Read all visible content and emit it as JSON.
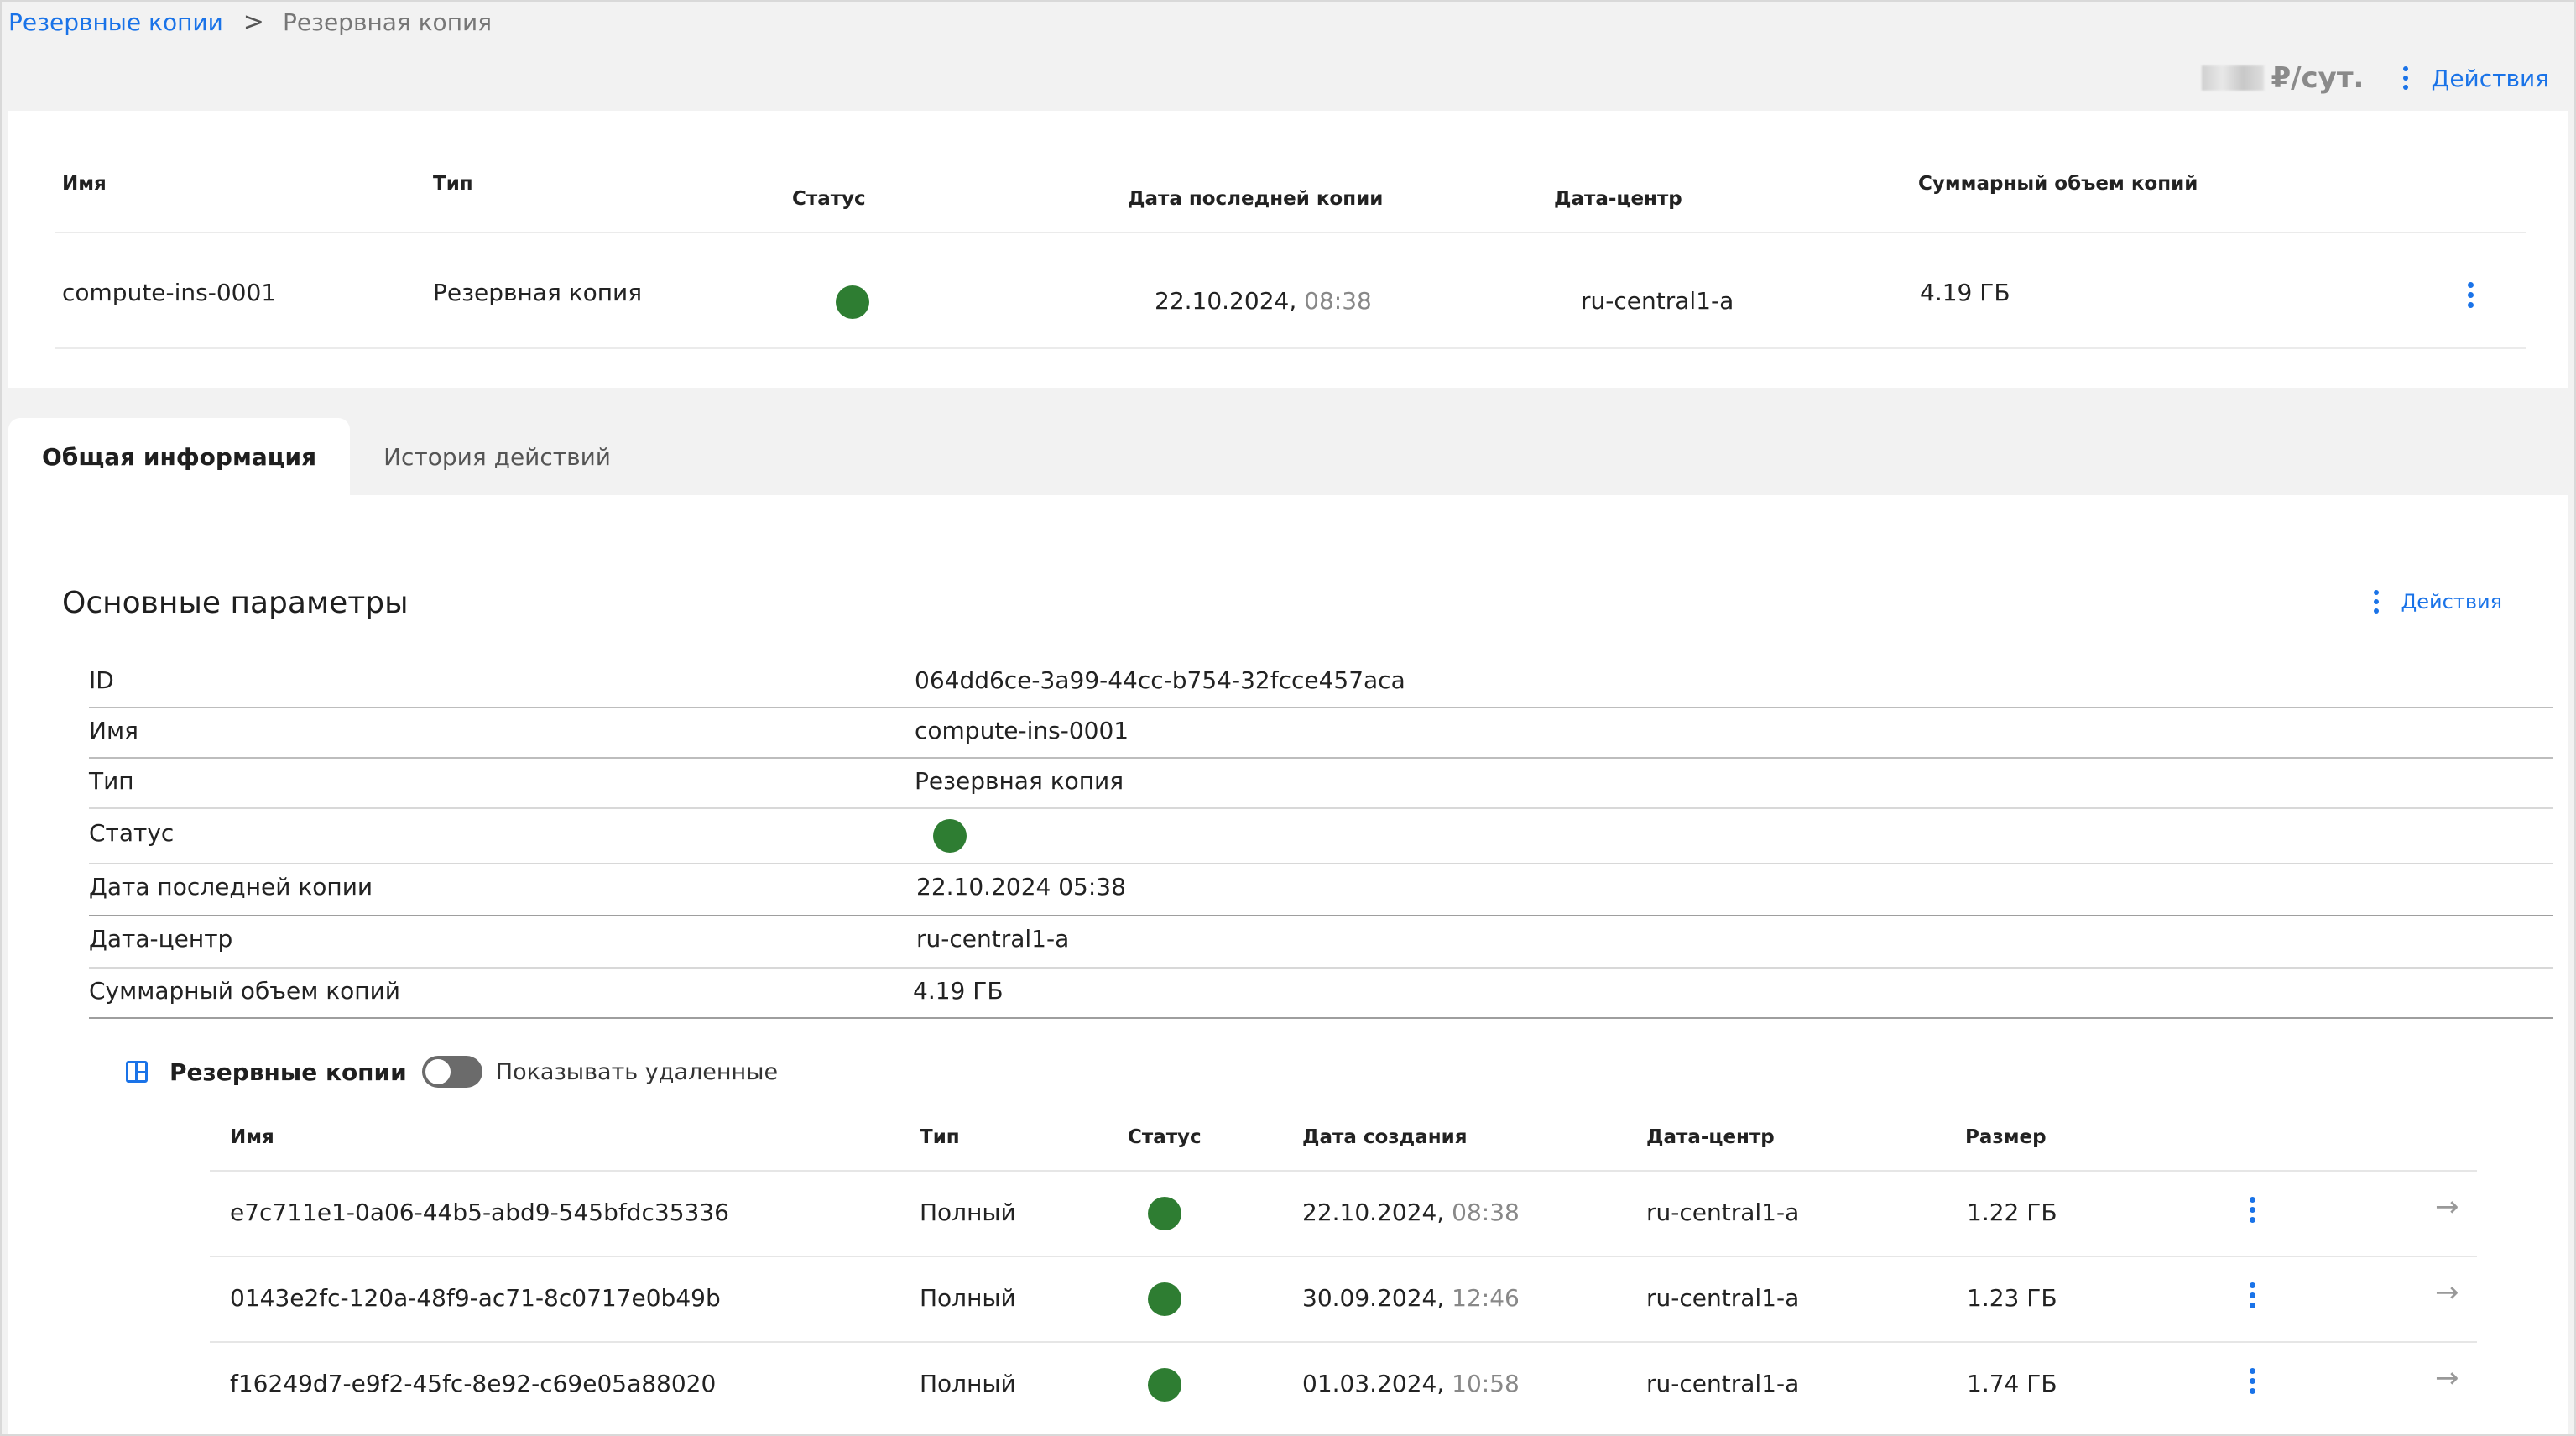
{
  "breadcrumb": {
    "root": "Резервные копии",
    "separator": ">",
    "current": "Резервная копия"
  },
  "top": {
    "price_unit": "₽/сут.",
    "actions_label": "Действия"
  },
  "summary": {
    "headers": {
      "name": "Имя",
      "type": "Тип",
      "status": "Статус",
      "last_copy": "Дата последней копии",
      "datacenter": "Дата-центр",
      "total_size": "Суммарный объем копий"
    },
    "row": {
      "name": "compute-ins-0001",
      "type": "Резервная копия",
      "status_color": "#2e7d32",
      "date": "22.10.2024,",
      "time": "08:38",
      "datacenter": "ru-central1-a",
      "total_size": "4.19 ГБ"
    }
  },
  "tabs": [
    {
      "label": "Общая информация",
      "active": true
    },
    {
      "label": "История действий",
      "active": false
    }
  ],
  "params": {
    "title": "Основные параметры",
    "actions_label": "Действия",
    "rows": [
      {
        "key": "ID",
        "value": "064dd6ce-3a99-44cc-b754-32fcce457aca"
      },
      {
        "key": "Имя",
        "value": "compute-ins-0001"
      },
      {
        "key": "Тип",
        "value": "Резервная копия"
      },
      {
        "key": "Статус",
        "value": ""
      },
      {
        "key": "Дата последней копии",
        "value": "22.10.2024 05:38"
      },
      {
        "key": "Дата-центр",
        "value": "ru-central1-a"
      },
      {
        "key": "Суммарный объем копий",
        "value": "4.19 ГБ"
      }
    ]
  },
  "backups": {
    "title": "Резервные копии",
    "toggle_label": "Показывать удаленные",
    "toggle_on": false,
    "headers": {
      "name": "Имя",
      "type": "Тип",
      "status": "Статус",
      "created": "Дата создания",
      "datacenter": "Дата-центр",
      "size": "Размер"
    },
    "rows": [
      {
        "name": "e7c711e1-0a06-44b5-abd9-545bfdc35336",
        "type": "Полный",
        "date": "22.10.2024,",
        "time": "08:38",
        "datacenter": "ru-central1-a",
        "size": "1.22 ГБ"
      },
      {
        "name": "0143e2fc-120a-48f9-ac71-8c0717e0b49b",
        "type": "Полный",
        "date": "30.09.2024,",
        "time": "12:46",
        "datacenter": "ru-central1-a",
        "size": "1.23 ГБ"
      },
      {
        "name": "f16249d7-e9f2-45fc-8e92-c69e05a88020",
        "type": "Полный",
        "date": "01.03.2024,",
        "time": "10:58",
        "datacenter": "ru-central1-a",
        "size": "1.74 ГБ"
      }
    ]
  },
  "colors": {
    "accent": "#1a73e8",
    "status_ok": "#2e7d32"
  }
}
